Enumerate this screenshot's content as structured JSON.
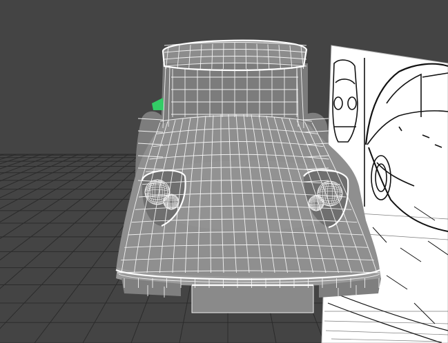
{
  "viewport": {
    "panel": "perspective-viewport",
    "display_mode": "smooth-shaded-wireframe-on-shaded",
    "colors": {
      "background": "#444444",
      "grid_line": "#2b2b2b",
      "wire": "#f2f2f2",
      "mesh_shade": "#8e8e8e",
      "selection_highlight": "#33cc66",
      "image_plane_paper": "#ffffff",
      "image_plane_ink": "#111111"
    },
    "objects": [
      {
        "name": "ground-grid",
        "kind": "grid"
      },
      {
        "name": "reference-image-plane",
        "kind": "image-plane"
      },
      {
        "name": "car-model",
        "kind": "polygon-mesh"
      }
    ]
  }
}
